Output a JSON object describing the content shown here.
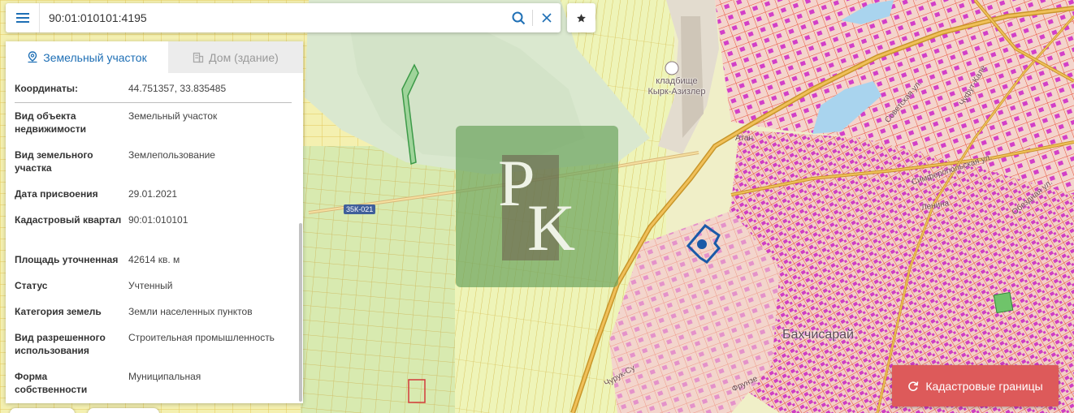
{
  "search": {
    "value": "90:01:010101:4195",
    "placeholder": ""
  },
  "tabs": [
    {
      "label": "Земельный участок",
      "icon": "map-pin-icon",
      "active": true
    },
    {
      "label": "Дом (здание)",
      "icon": "building-icon",
      "active": false
    }
  ],
  "details": [
    {
      "key": "Координаты:",
      "value": "44.751357, 33.835485"
    },
    {
      "key": "Вид объекта недвижимости",
      "value": "Земельный участок"
    },
    {
      "key": "Вид земельного участка",
      "value": "Землепользование"
    },
    {
      "key": "Дата присвоения",
      "value": "29.01.2021"
    },
    {
      "key": "Кадастровый квартал",
      "value": "90:01:010101"
    },
    {
      "key": "Площадь уточненная",
      "value": "42614 кв. м"
    },
    {
      "key": "Статус",
      "value": "Учтенный"
    },
    {
      "key": "Категория земель",
      "value": "Земли населенных пунктов"
    },
    {
      "key": "Вид разрешенного использования",
      "value": "Строительная промышленность"
    },
    {
      "key": "Форма собственности",
      "value": "Муниципальная"
    }
  ],
  "map": {
    "cemetery_label": "кладбище Кырк-Азизлер",
    "city_label": "Бахчисарай",
    "road_shield": "35К-021",
    "street_labels": [
      "Симферопольская ул.",
      "Обездная ул.",
      "Ленина",
      "Фрунзе",
      "Чуфут-Кале",
      "Чурук-Су",
      "Советская ул.",
      "Атан"
    ]
  },
  "watermark": {
    "letter_top": "P",
    "letter_bottom": "K"
  },
  "cadastral_button": {
    "label": "Кадастровые границы",
    "icon": "refresh-icon"
  },
  "colors": {
    "accent": "#1e6fb5",
    "cadastral_button": "#dd5a5a",
    "parcel_marker": "#1a5aa8",
    "urban_parcel": "#e8503a",
    "building": "#d23fc8"
  }
}
